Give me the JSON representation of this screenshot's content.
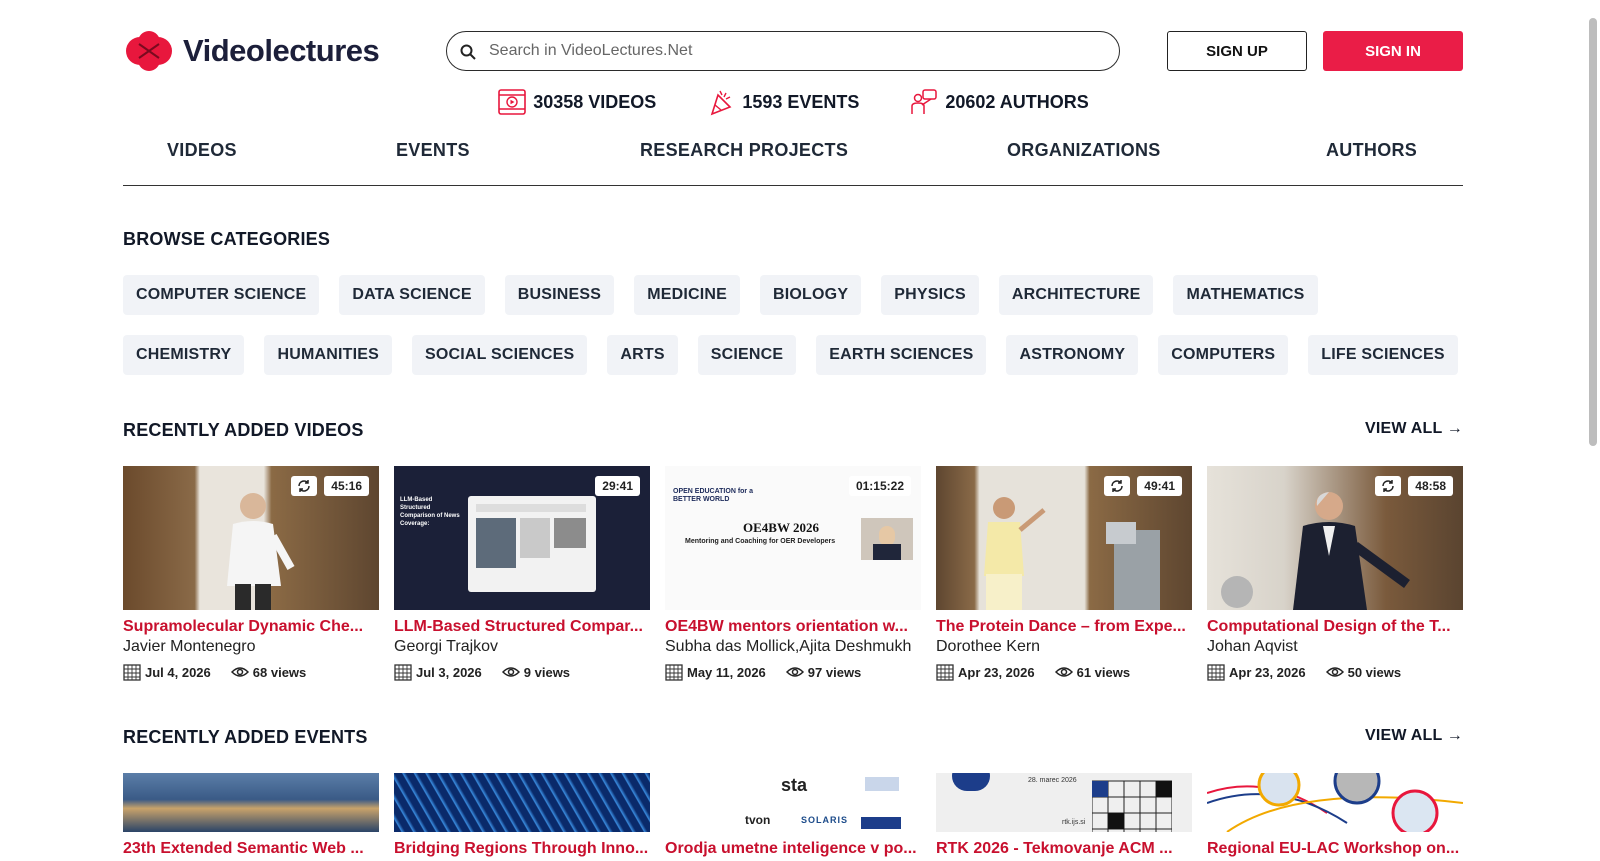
{
  "header": {
    "logo_text": "Videolectures",
    "search_placeholder": "Search in VideoLectures.Net",
    "signup_label": "SIGN UP",
    "signin_label": "SIGN IN",
    "accent_color": "#ea1d47"
  },
  "stats": [
    {
      "icon": "video-icon",
      "label": "30358 VIDEOS"
    },
    {
      "icon": "events-icon",
      "label": "1593 EVENTS"
    },
    {
      "icon": "authors-icon",
      "label": "20602 AUTHORS"
    }
  ],
  "nav": [
    "VIDEOS",
    "EVENTS",
    "RESEARCH PROJECTS",
    "ORGANIZATIONS",
    "AUTHORS"
  ],
  "categories": {
    "title": "BROWSE CATEGORIES",
    "row1": [
      "COMPUTER SCIENCE",
      "DATA SCIENCE",
      "BUSINESS",
      "MEDICINE",
      "BIOLOGY",
      "PHYSICS",
      "ARCHITECTURE",
      "MATHEMATICS"
    ],
    "row2": [
      "CHEMISTRY",
      "HUMANITIES",
      "SOCIAL SCIENCES",
      "ARTS",
      "SCIENCE",
      "EARTH SCIENCES",
      "ASTRONOMY",
      "COMPUTERS",
      "LIFE SCIENCES"
    ]
  },
  "recent_videos": {
    "title": "RECENTLY ADDED VIDEOS",
    "view_all": "VIEW ALL →",
    "items": [
      {
        "title": "Supramolecular Dynamic Che...",
        "author": "Javier Montenegro",
        "date": "Jul 4, 2026",
        "views": "68 views",
        "duration": "45:16",
        "sync": true
      },
      {
        "title": "LLM-Based Structured Compar...",
        "author": "Georgi Trajkov",
        "date": "Jul 3, 2026",
        "views": "9 views",
        "duration": "29:41",
        "sync": false
      },
      {
        "title": "OE4BW mentors orientation w...",
        "author": "Subha das Mollick,Ajita Deshmukh",
        "date": "May 11, 2026",
        "views": "97 views",
        "duration": "01:15:22",
        "sync": false
      },
      {
        "title": "The Protein Dance – from Expe...",
        "author": "Dorothee Kern",
        "date": "Apr 23, 2026",
        "views": "61 views",
        "duration": "49:41",
        "sync": true
      },
      {
        "title": "Computational Design of the T...",
        "author": "Johan Aqvist",
        "date": "Apr 23, 2026",
        "views": "50 views",
        "duration": "48:58",
        "sync": true
      }
    ]
  },
  "thumb_text": {
    "llm_title": "LLM-Based Structured Comparison of News Coverage:",
    "oe_brand": "OPEN EDUCATION for a BETTER WORLD",
    "oe_title": "OE4BW 2026",
    "oe_subtitle": "Mentoring and Coaching for OER Developers",
    "rtk_date": "28. marec 2026",
    "rtk_site": "rtk.ijs.si",
    "logos": [
      "sta",
      "tvon",
      "SOLARIS"
    ]
  },
  "recent_events": {
    "title": "RECENTLY ADDED EVENTS",
    "view_all": "VIEW ALL →",
    "items": [
      {
        "title": "23th Extended Semantic Web ..."
      },
      {
        "title": "Bridging Regions Through Inno..."
      },
      {
        "title": "Orodja umetne inteligence v po..."
      },
      {
        "title": "RTK 2026 - Tekmovanje ACM ..."
      },
      {
        "title": "Regional EU-LAC Workshop on..."
      }
    ]
  }
}
